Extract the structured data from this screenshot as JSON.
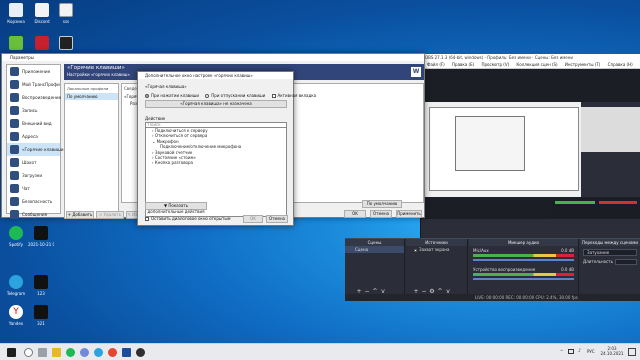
{
  "desktop": {
    "icons": [
      {
        "label": "Корзина",
        "color": "#e8eef5"
      },
      {
        "label": "Discord",
        "color": "#f4f4f4"
      },
      {
        "label": "sss",
        "color": "#f2f2f2"
      },
      {
        "label": "",
        "color": "#6abf3a"
      },
      {
        "label": "",
        "color": "#c8202f"
      },
      {
        "label": "",
        "color": "#222"
      },
      {
        "label": "Spotify",
        "color": "#1db954"
      },
      {
        "label": "2021-10-21 00-48-17",
        "color": "#111"
      },
      {
        "label": "Telegram",
        "color": "#2aa3df"
      },
      {
        "label": "123",
        "color": "#111"
      },
      {
        "label": "Yandex",
        "color": "#ffffff"
      },
      {
        "label": "321",
        "color": "#111"
      }
    ]
  },
  "obs": {
    "title": "OBS 27.1.3 (64-bit, windows) - Профиль: Без имени - Сцены: Без имени",
    "menu": [
      "Файл (F)",
      "Правка (E)",
      "Просмотр (V)",
      "Коллекция сцен (S)",
      "Инструменты (T)",
      "Справка (H)"
    ],
    "docks": {
      "scenes": "Сцены",
      "sources": "Источники",
      "mixer": "Микшер аудио",
      "transitions": "Переходы между сценами",
      "controls": "Управление"
    },
    "scene_item": "Сцена",
    "source_item": "Захват экрана",
    "mixer_tracks": [
      {
        "name": "Mic/Aux",
        "level": "0.0 dB"
      },
      {
        "name": "Устройство воспроизведения",
        "level": "0.0 dB"
      }
    ],
    "transition_value": "Затухание",
    "duration_label": "Длительность",
    "controls": [
      "Запустить трансляцию",
      "Начать запись",
      "Режим студии",
      "Настройки",
      "Выход"
    ],
    "status": "LIVE: 00:00:00   REC: 00:00:00   CPU: 2.4%, 30.00 fps"
  },
  "settings": {
    "title": "Параметры",
    "sidebar": [
      "Приложение",
      "Мой ТрансПрофи",
      "Воспроизведение",
      "Запись",
      "Внешний вид",
      "Адреса",
      "«Горячие клавиши»",
      "Шахот",
      "Загрузки",
      "Чат",
      "Безопасность",
      "Сообщения",
      "Уведомления"
    ],
    "active_index": 6,
    "header_title": "«Горячие клавиши»",
    "header_sub": "Настройки «горячих клавиш»",
    "profiles_label": "Локальные профили",
    "profiles_col": "Сведения о профиле",
    "profiles_item": "По умолчанию",
    "main_label_1": "«Горячие клавиши»",
    "main_label_2": "Разд",
    "add_btn": "Добавить",
    "delete_btn": "Удалить",
    "edit_btn": "Изменить",
    "default_btn": "По умолчанию",
    "ok_btn": "OK",
    "cancel_btn": "Отмена",
    "apply_btn": "Применить",
    "badge": "W"
  },
  "hotkey_dialog": {
    "title": "Дополнительное окно настроек «горячих клавиш»",
    "group_label": "«Горячая клавиша»",
    "radio_press": "При нажатии клавиши",
    "radio_release": "При отпускании клавиши",
    "checkbox_active": "Активная вкладка",
    "assign_button": "«Горячая клавиша» не назначена",
    "actions_label": "Действие",
    "search_placeholder": "Поиск",
    "tree": [
      {
        "label": "Подключиться к серверу",
        "level": 1
      },
      {
        "label": "Отключиться от сервера",
        "level": 1
      },
      {
        "label": "Микрофон",
        "level": 1
      },
      {
        "label": "Подключение/отключение микрофона",
        "level": 2
      },
      {
        "label": "Звуковой счетчик",
        "level": 1
      },
      {
        "label": "Состояние «стоим»",
        "level": 1
      },
      {
        "label": "Кнопка разговора",
        "level": 1
      }
    ],
    "show_more": "Показать дополнительные действия",
    "leave_open": "Оставить диалоговое окно открытым",
    "ok": "OK",
    "cancel": "Отмена"
  },
  "taskbar": {
    "lang": "РУС",
    "time": "2:03",
    "date": "24.10.2021"
  }
}
